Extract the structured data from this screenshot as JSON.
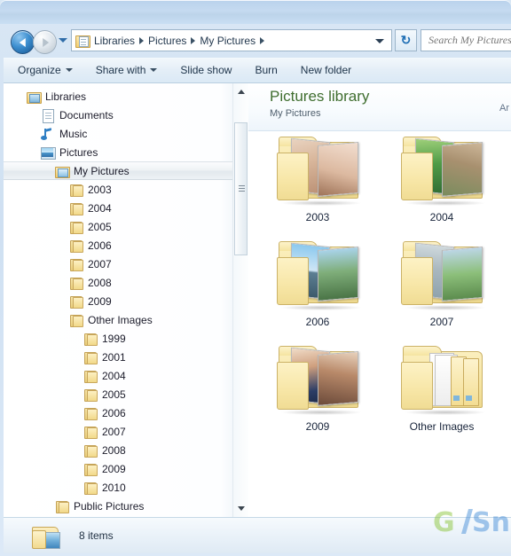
{
  "window": {
    "title": ""
  },
  "navigation": {
    "back_icon": "back-arrow-icon",
    "forward_icon": "forward-arrow-icon",
    "history_dropdown_icon": "chevron-down-icon",
    "refresh_label": "↻",
    "breadcrumb": {
      "root_icon": "libraries-icon",
      "items": [
        "Libraries",
        "Pictures",
        "My Pictures"
      ],
      "separator": "▸",
      "dropdown_icon": "chevron-down-icon"
    }
  },
  "search": {
    "placeholder": "Search My Pictures",
    "value": ""
  },
  "toolbar": {
    "items": [
      {
        "label": "Organize",
        "has_caret": true
      },
      {
        "label": "Share with",
        "has_caret": true
      },
      {
        "label": "Slide show",
        "has_caret": false
      },
      {
        "label": "Burn",
        "has_caret": false
      },
      {
        "label": "New folder",
        "has_caret": false
      }
    ]
  },
  "nav_pane": {
    "tree": [
      {
        "label": "Libraries",
        "icon": "libraries-icon",
        "indent": 0,
        "selected": false
      },
      {
        "label": "Documents",
        "icon": "document-icon",
        "indent": 1,
        "selected": false
      },
      {
        "label": "Music",
        "icon": "music-note-icon",
        "indent": 1,
        "selected": false
      },
      {
        "label": "Pictures",
        "icon": "pictures-icon",
        "indent": 1,
        "selected": false
      },
      {
        "label": "My Pictures",
        "icon": "my-pictures-icon",
        "indent": 2,
        "selected": true
      },
      {
        "label": "2003",
        "icon": "folder-icon",
        "indent": 3,
        "selected": false
      },
      {
        "label": "2004",
        "icon": "folder-icon",
        "indent": 3,
        "selected": false
      },
      {
        "label": "2005",
        "icon": "folder-icon",
        "indent": 3,
        "selected": false
      },
      {
        "label": "2006",
        "icon": "folder-icon",
        "indent": 3,
        "selected": false
      },
      {
        "label": "2007",
        "icon": "folder-icon",
        "indent": 3,
        "selected": false
      },
      {
        "label": "2008",
        "icon": "folder-icon",
        "indent": 3,
        "selected": false
      },
      {
        "label": "2009",
        "icon": "folder-icon",
        "indent": 3,
        "selected": false
      },
      {
        "label": "Other Images",
        "icon": "folder-icon",
        "indent": 3,
        "selected": false
      },
      {
        "label": "1999",
        "icon": "folder-icon",
        "indent": 4,
        "selected": false
      },
      {
        "label": "2001",
        "icon": "folder-icon",
        "indent": 4,
        "selected": false
      },
      {
        "label": "2004",
        "icon": "folder-icon",
        "indent": 4,
        "selected": false
      },
      {
        "label": "2005",
        "icon": "folder-icon",
        "indent": 4,
        "selected": false
      },
      {
        "label": "2006",
        "icon": "folder-icon",
        "indent": 4,
        "selected": false
      },
      {
        "label": "2007",
        "icon": "folder-icon",
        "indent": 4,
        "selected": false
      },
      {
        "label": "2008",
        "icon": "folder-icon",
        "indent": 4,
        "selected": false
      },
      {
        "label": "2009",
        "icon": "folder-icon",
        "indent": 4,
        "selected": false
      },
      {
        "label": "2010",
        "icon": "folder-icon",
        "indent": 4,
        "selected": false
      },
      {
        "label": "Public Pictures",
        "icon": "folder-icon",
        "indent": 2,
        "selected": false
      }
    ],
    "scrollbar": {
      "up_icon": "scroll-up-arrow-icon",
      "down_icon": "scroll-down-arrow-icon"
    }
  },
  "content": {
    "library_title": "Pictures library",
    "library_subtitle": "My Pictures",
    "arrange_label": "Ar",
    "folders": [
      {
        "name": "2003",
        "thumb": "baby-portrait"
      },
      {
        "name": "2004",
        "thumb": "garden-flowers"
      },
      {
        "name": "2006",
        "thumb": "mountain-lake"
      },
      {
        "name": "2007",
        "thumb": "beach-shore"
      },
      {
        "name": "2009",
        "thumb": "two-children"
      },
      {
        "name": "Other Images",
        "thumb": "subfolders"
      }
    ]
  },
  "status": {
    "icon": "folder-picture-icon",
    "text": "8 items"
  },
  "watermark": {
    "left_text": "G",
    "right_text": "Sn"
  },
  "colors": {
    "title_green": "#3f6e2f",
    "chrome_blue": "#cfe0f2",
    "folder_yellow": "#f2da8e",
    "accent_blue": "#2f7fc4"
  }
}
